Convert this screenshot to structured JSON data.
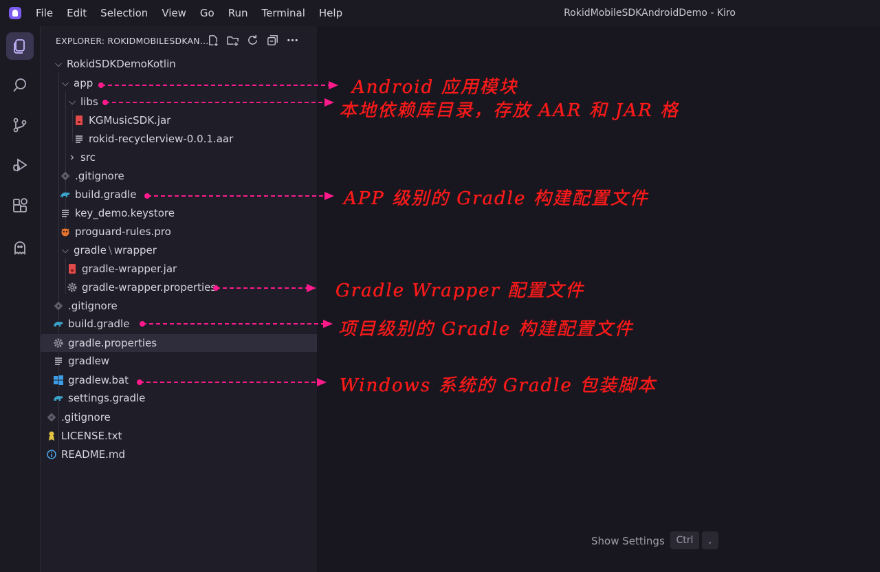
{
  "window": {
    "title": "RokidMobileSDKAndroidDemo - Kiro"
  },
  "menu": [
    "File",
    "Edit",
    "Selection",
    "View",
    "Go",
    "Run",
    "Terminal",
    "Help"
  ],
  "activity": [
    "explorer-icon",
    "search-icon",
    "source-control-icon",
    "run-debug-icon",
    "extensions-icon",
    "kiro-ghost-icon"
  ],
  "explorer": {
    "title": "EXPLORER: ROKIDMOBILESDKAN...",
    "actions": [
      "new-file-icon",
      "new-folder-icon",
      "refresh-icon",
      "collapse-all-icon",
      "more-icon"
    ],
    "tree": [
      {
        "label": "RokidSDKDemoKotlin",
        "twisty": "v",
        "icon": ""
      },
      {
        "label": "app",
        "twisty": "v",
        "icon": ""
      },
      {
        "label": "libs",
        "twisty": "v",
        "icon": ""
      },
      {
        "label": "KGMusicSDK.jar",
        "twisty": "",
        "icon": "jar-file-icon"
      },
      {
        "label": "rokid-recyclerview-0.0.1.aar",
        "twisty": "",
        "icon": "text-file-icon"
      },
      {
        "label": "src",
        "twisty": ">",
        "icon": ""
      },
      {
        "label": ".gitignore",
        "twisty": "",
        "icon": "git-file-icon"
      },
      {
        "label": "build.gradle",
        "twisty": "",
        "icon": "gradle-file-icon"
      },
      {
        "label": "key_demo.keystore",
        "twisty": "",
        "icon": "text-file-icon"
      },
      {
        "label": "proguard-rules.pro",
        "twisty": "",
        "icon": "proguard-file-icon"
      },
      {
        "label": "gradle",
        "label2": "wrapper",
        "twisty": "v",
        "icon": ""
      },
      {
        "label": "gradle-wrapper.jar",
        "twisty": "",
        "icon": "jar-file-icon"
      },
      {
        "label": "gradle-wrapper.properties",
        "twisty": "",
        "icon": "settings-file-icon"
      },
      {
        "label": ".gitignore",
        "twisty": "",
        "icon": "git-file-icon"
      },
      {
        "label": "build.gradle",
        "twisty": "",
        "icon": "gradle-file-icon"
      },
      {
        "label": "gradle.properties",
        "twisty": "",
        "icon": "settings-file-icon",
        "selected": true
      },
      {
        "label": "gradlew",
        "twisty": "",
        "icon": "text-file-icon"
      },
      {
        "label": "gradlew.bat",
        "twisty": "",
        "icon": "windows-file-icon"
      },
      {
        "label": "settings.gradle",
        "twisty": "",
        "icon": "gradle-file-icon"
      },
      {
        "label": ".gitignore",
        "twisty": "",
        "icon": "git-file-icon"
      },
      {
        "label": "LICENSE.txt",
        "twisty": "",
        "icon": "license-file-icon"
      },
      {
        "label": "README.md",
        "twisty": "",
        "icon": "info-file-icon"
      }
    ]
  },
  "editor": {
    "show_settings": "Show Settings",
    "key_ctrl": "Ctrl",
    "key_comma": ","
  },
  "annotations": [
    "Android 应用模块",
    "本地依赖库目录，存放 AAR 和 JAR 格",
    "APP 级别的 Gradle 构建配置文件",
    "Gradle Wrapper 配置文件",
    "项目级别的 Gradle 构建配置文件",
    "Windows 系统的 Gradle 包装脚本"
  ],
  "colors": {
    "accent": "#7c5cf0",
    "annotation": "#ff1a1a",
    "arrow": "#ff1a8c"
  }
}
